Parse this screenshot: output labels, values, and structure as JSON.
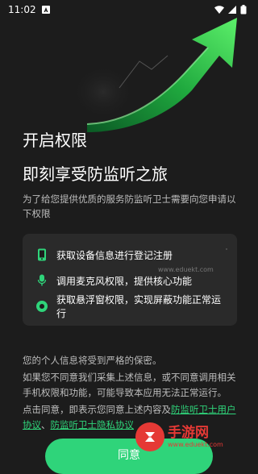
{
  "status_bar": {
    "time": "11:02"
  },
  "title_line1": "开启权限",
  "title_line2": "即刻享受防监听之旅",
  "subtitle": "为了给您提供优质的服务防监听卫士需要向您申请以下权限",
  "permissions": [
    {
      "label": "获取设备信息进行登记注册",
      "icon": "phone-icon"
    },
    {
      "label": "调用麦克风权限，提供核心功能",
      "icon": "microphone-icon"
    },
    {
      "label": "获取悬浮窗权限，实现屏蔽功能正常运行",
      "icon": "floating-window-icon"
    }
  ],
  "notice": {
    "line1": "您的个人信息将受到严格的保密。",
    "line2": "如果您不同意我们采集上述信息，或不同意调用相关手机权限和功能，可能导致本应用无法正常运行。",
    "line3_prefix": "点击同意，即表示您同意上述内容及",
    "user_agreement_link": "防监听卫士用户协议",
    "separator": "、",
    "privacy_link": "防监听卫士隐私协议"
  },
  "agree_button_label": "同意",
  "watermark": {
    "text": "手游网",
    "site": "www.eduekt.com",
    "faint": "www.eduekt.com"
  },
  "colors": {
    "background": "#1c1c1c",
    "accent": "#2fd47a",
    "card": "#2a2a2a"
  }
}
